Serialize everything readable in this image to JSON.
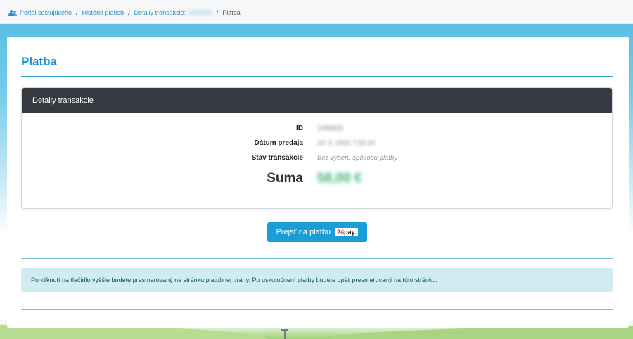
{
  "breadcrumb": {
    "items": [
      {
        "label": "Portál cestujúceho"
      },
      {
        "label": "História platieb"
      },
      {
        "label": "Detaily transakcie:"
      }
    ],
    "reference": "1369825",
    "separator": "/",
    "current": "Platba"
  },
  "page": {
    "title": "Platba"
  },
  "panel": {
    "header": "Detaily transakcie",
    "fields": {
      "id_label": "ID",
      "id_value": "1369825",
      "date_label": "Dátum predaja",
      "date_value": "14. 5. 2021 7:25:10",
      "status_label": "Stav transakcie",
      "status_value": "Bez výberu spôsobu platby",
      "sum_label": "Suma",
      "sum_value": "58,00 €"
    }
  },
  "pay_button": {
    "label": "Prejsť na platbu",
    "logo_number": "24",
    "logo_text": "pay."
  },
  "alert": {
    "text": "Po kliknutí na tlačidlo vyššie budete presmerovaný na stránku platobnej brány. Po uskutočnení platby budete opäť presmerovaný na túto stránku."
  },
  "colors": {
    "accent": "#1c90c9",
    "panel_header": "#343a40",
    "button": "#1a9ed8",
    "alert_bg": "#d1ecf1",
    "amount": "#3cb371"
  },
  "icons": {
    "breadcrumb_home": "users-icon",
    "payment_logo": "24pay-logo"
  }
}
